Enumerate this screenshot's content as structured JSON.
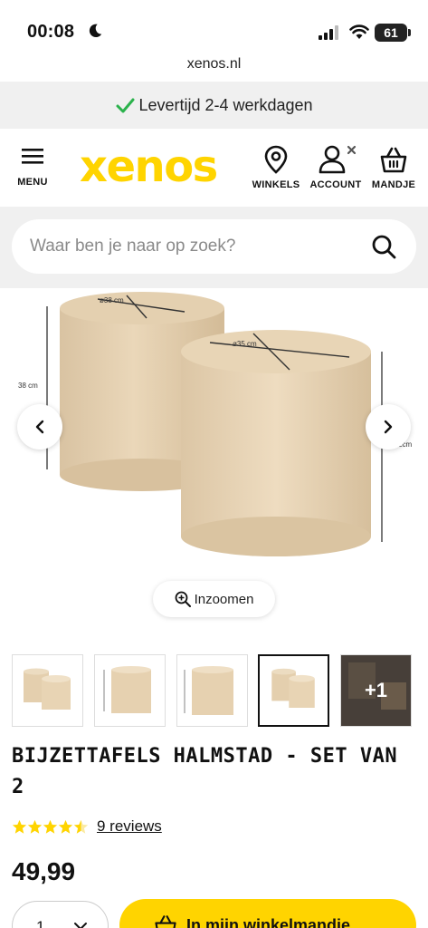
{
  "status_bar": {
    "time": "00:08",
    "battery": "61"
  },
  "url": "xenos.nl",
  "delivery": {
    "text": "Levertijd 2-4 werkdagen"
  },
  "header": {
    "logo": "xenos",
    "menu_label": "MENU",
    "stores_label": "WINKELS",
    "account_label": "ACCOUNT",
    "cart_label": "MANDJE"
  },
  "search": {
    "placeholder": "Waar ben je naar op zoek?"
  },
  "image_labels": {
    "left_diameter": "ø38 cm",
    "right_diameter": "ø35 cm",
    "left_height": "38 cm",
    "right_height": "2cm"
  },
  "zoom_label": "Inzoomen",
  "thumbnails": {
    "count": 5,
    "active_index": 3,
    "more_label": "+1"
  },
  "product": {
    "title": "BIJZETTAFELS HALMSTAD - SET VAN 2",
    "rating": 4.5,
    "reviews": "9 reviews",
    "price": "49,99"
  },
  "purchase": {
    "quantity": "1",
    "add_to_cart_label": "In mijn winkelmandje"
  },
  "colors": {
    "brand_yellow": "#ffd400",
    "check_green": "#2bb24c",
    "wood": "#e6d2b3"
  }
}
